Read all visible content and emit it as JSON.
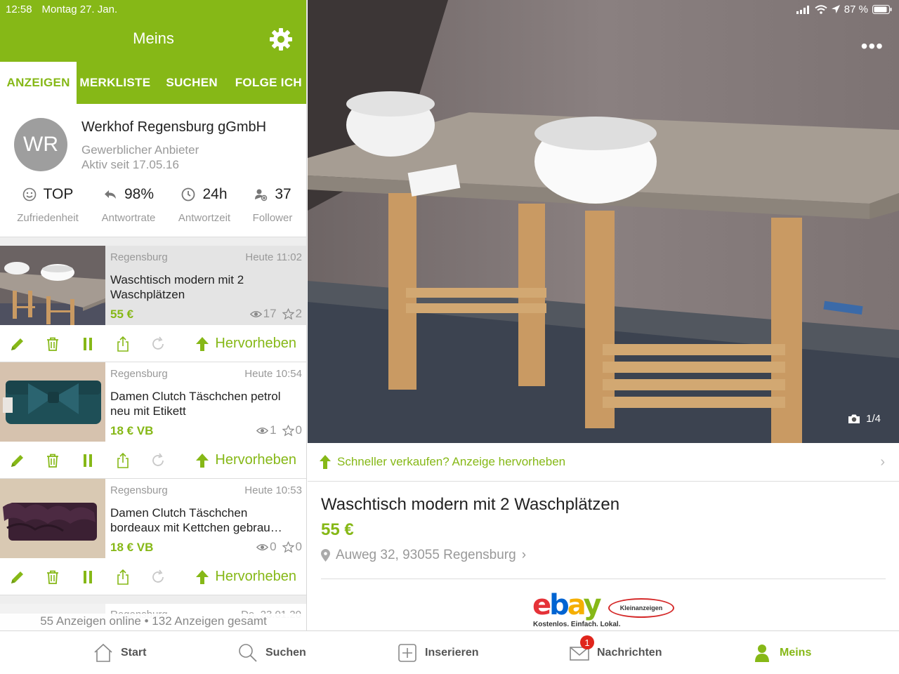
{
  "status_bar": {
    "time": "12:58",
    "date": "Montag 27. Jan.",
    "battery": "87 %"
  },
  "header": {
    "title": "Meins"
  },
  "tabs": [
    {
      "label": "ANZEIGEN",
      "active": true
    },
    {
      "label": "MERKLISTE",
      "active": false
    },
    {
      "label": "SUCHEN",
      "active": false
    },
    {
      "label": "FOLGE ICH",
      "active": false
    }
  ],
  "profile": {
    "initials": "WR",
    "name": "Werkhof Regensburg gGmbH",
    "type": "Gewerblicher Anbieter",
    "since": "Aktiv seit 17.05.16",
    "stats": [
      {
        "icon": "smiley-icon",
        "value": "TOP",
        "label": "Zufriedenheit"
      },
      {
        "icon": "reply-icon",
        "value": "98%",
        "label": "Antwortrate"
      },
      {
        "icon": "clock-icon",
        "value": "24h",
        "label": "Antwortzeit"
      },
      {
        "icon": "follower-icon",
        "value": "37",
        "label": "Follower"
      }
    ]
  },
  "listings": [
    {
      "location": "Regensburg",
      "date": "Heute 11:02",
      "title": "Waschtisch modern mit 2 Waschplätzen",
      "price": "55 €",
      "views": "17",
      "watchers": "2",
      "thumb": "washstand"
    },
    {
      "location": "Regensburg",
      "date": "Heute 10:54",
      "title": "Damen Clutch Täschchen petrol neu mit Etikett",
      "price": "18 € VB",
      "views": "1",
      "watchers": "0",
      "thumb": "petrol-clutch"
    },
    {
      "location": "Regensburg",
      "date": "Heute 10:53",
      "title": "Damen Clutch Täschchen bordeaux mit Kettchen gebrau…",
      "price": "18 € VB",
      "views": "0",
      "watchers": "0",
      "thumb": "bordeaux-clutch"
    }
  ],
  "partial_listing": {
    "location": "Regensburg",
    "date": "Do. 23.01.20"
  },
  "promote_label": "Hervorheben",
  "summary": "55 Anzeigen online • 132 Anzeigen gesamt",
  "detail": {
    "photo_counter": "1/4",
    "boost_text": "Schneller verkaufen? Anzeige hervorheben",
    "title": "Waschtisch modern mit 2 Waschplätzen",
    "price": "55 €",
    "address": "Auweg 32, 93055 Regensburg",
    "logo_word": "ebay",
    "logo_badge": "Kleinanzeigen",
    "logo_tagline": "Kostenlos. Einfach. Lokal."
  },
  "bottom_nav": [
    {
      "label": "Start",
      "icon": "home-icon"
    },
    {
      "label": "Suchen",
      "icon": "search-icon"
    },
    {
      "label": "Inserieren",
      "icon": "plus-square-icon"
    },
    {
      "label": "Nachrichten",
      "icon": "mail-icon",
      "badge": "1"
    },
    {
      "label": "Meins",
      "icon": "person-icon",
      "active": true
    }
  ],
  "colors": {
    "accent": "#86b817",
    "badge": "#e0251c"
  }
}
